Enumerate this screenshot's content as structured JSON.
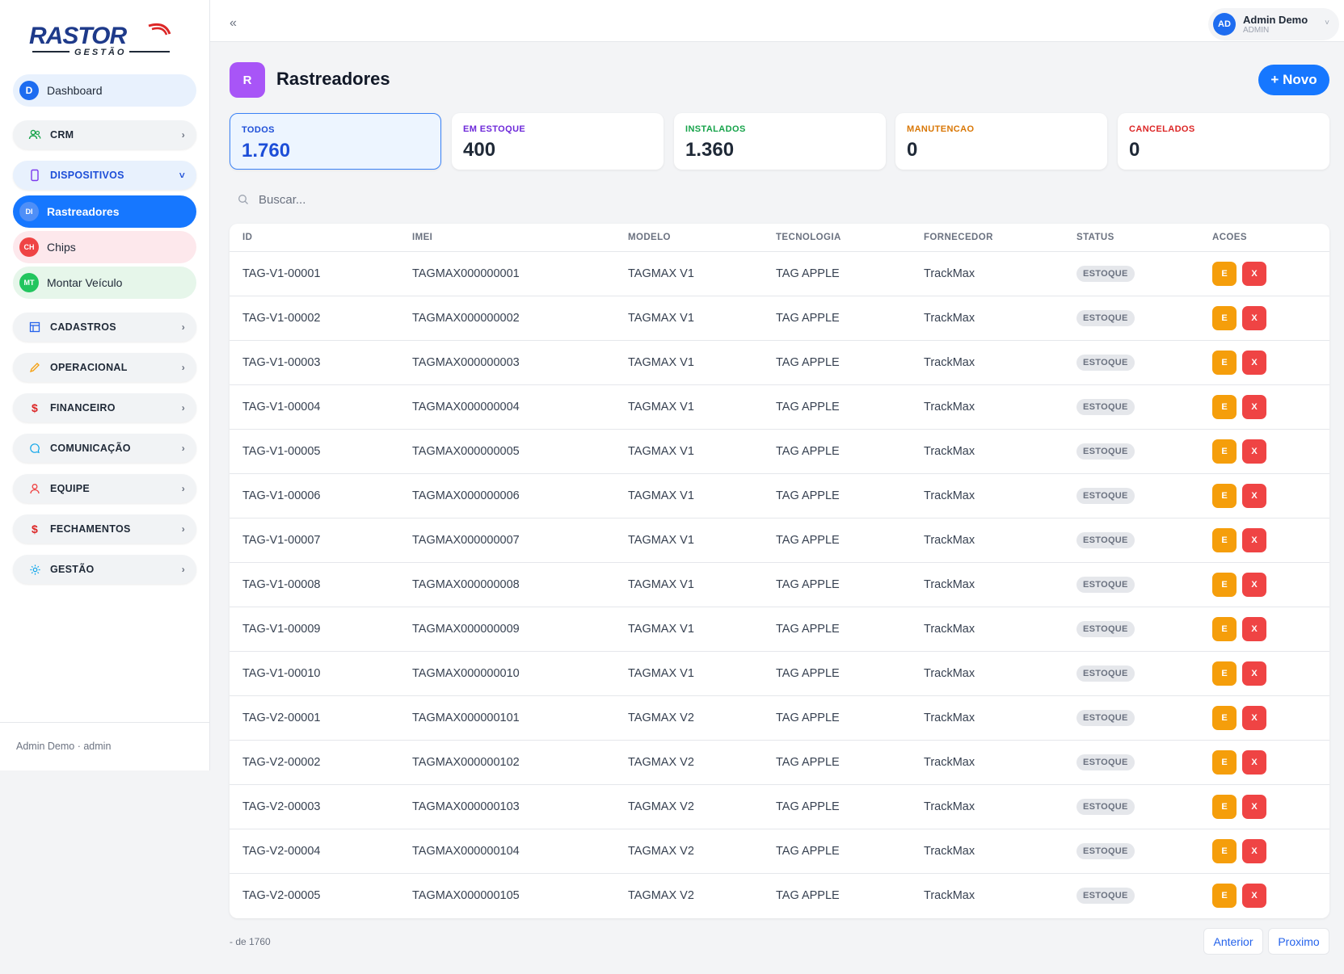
{
  "brand": {
    "logo_text": "RASTOR",
    "logo_sub": "GESTÃO"
  },
  "sidebar": {
    "dashboard": {
      "badge": "D",
      "label": "Dashboard"
    },
    "crm": {
      "label": "CRM"
    },
    "dispositivos": {
      "label": "DISPOSITIVOS",
      "items": [
        {
          "badge": "DI",
          "label": "Rastreadores"
        },
        {
          "badge": "CH",
          "label": "Chips"
        },
        {
          "badge": "MT",
          "label": "Montar Veículo"
        }
      ]
    },
    "groups": [
      "CADASTROS",
      "OPERACIONAL",
      "FINANCEIRO",
      "COMUNICAÇÃO",
      "EQUIPE",
      "FECHAMENTOS",
      "GESTÃO"
    ],
    "footer": "Admin Demo · admin"
  },
  "topbar": {
    "collapse": "«",
    "user": {
      "initials": "AD",
      "name": "Admin Demo",
      "role": "ADMIN"
    }
  },
  "header": {
    "badge": "R",
    "title": "Rastreadores",
    "new_button": "+ Novo"
  },
  "stats": [
    {
      "label": "TODOS",
      "value": "1.760",
      "color": "#1d4ed8"
    },
    {
      "label": "EM ESTOQUE",
      "value": "400",
      "color": "#6d28d9"
    },
    {
      "label": "INSTALADOS",
      "value": "1.360",
      "color": "#16a34a"
    },
    {
      "label": "MANUTENCAO",
      "value": "0",
      "color": "#d97706"
    },
    {
      "label": "CANCELADOS",
      "value": "0",
      "color": "#dc2626"
    }
  ],
  "search": {
    "placeholder": "Buscar..."
  },
  "table": {
    "columns": [
      "ID",
      "IMEI",
      "MODELO",
      "TECNOLOGIA",
      "FORNECEDOR",
      "STATUS",
      "ACOES"
    ],
    "rows": [
      [
        "TAG-V1-00001",
        "TAGMAX000000001",
        "TAGMAX V1",
        "TAG APPLE",
        "TrackMax",
        "ESTOQUE"
      ],
      [
        "TAG-V1-00002",
        "TAGMAX000000002",
        "TAGMAX V1",
        "TAG APPLE",
        "TrackMax",
        "ESTOQUE"
      ],
      [
        "TAG-V1-00003",
        "TAGMAX000000003",
        "TAGMAX V1",
        "TAG APPLE",
        "TrackMax",
        "ESTOQUE"
      ],
      [
        "TAG-V1-00004",
        "TAGMAX000000004",
        "TAGMAX V1",
        "TAG APPLE",
        "TrackMax",
        "ESTOQUE"
      ],
      [
        "TAG-V1-00005",
        "TAGMAX000000005",
        "TAGMAX V1",
        "TAG APPLE",
        "TrackMax",
        "ESTOQUE"
      ],
      [
        "TAG-V1-00006",
        "TAGMAX000000006",
        "TAGMAX V1",
        "TAG APPLE",
        "TrackMax",
        "ESTOQUE"
      ],
      [
        "TAG-V1-00007",
        "TAGMAX000000007",
        "TAGMAX V1",
        "TAG APPLE",
        "TrackMax",
        "ESTOQUE"
      ],
      [
        "TAG-V1-00008",
        "TAGMAX000000008",
        "TAGMAX V1",
        "TAG APPLE",
        "TrackMax",
        "ESTOQUE"
      ],
      [
        "TAG-V1-00009",
        "TAGMAX000000009",
        "TAGMAX V1",
        "TAG APPLE",
        "TrackMax",
        "ESTOQUE"
      ],
      [
        "TAG-V1-00010",
        "TAGMAX000000010",
        "TAGMAX V1",
        "TAG APPLE",
        "TrackMax",
        "ESTOQUE"
      ],
      [
        "TAG-V2-00001",
        "TAGMAX000000101",
        "TAGMAX V2",
        "TAG APPLE",
        "TrackMax",
        "ESTOQUE"
      ],
      [
        "TAG-V2-00002",
        "TAGMAX000000102",
        "TAGMAX V2",
        "TAG APPLE",
        "TrackMax",
        "ESTOQUE"
      ],
      [
        "TAG-V2-00003",
        "TAGMAX000000103",
        "TAGMAX V2",
        "TAG APPLE",
        "TrackMax",
        "ESTOQUE"
      ],
      [
        "TAG-V2-00004",
        "TAGMAX000000104",
        "TAGMAX V2",
        "TAG APPLE",
        "TrackMax",
        "ESTOQUE"
      ],
      [
        "TAG-V2-00005",
        "TAGMAX000000105",
        "TAGMAX V2",
        "TAG APPLE",
        "TrackMax",
        "ESTOQUE"
      ]
    ],
    "action_edit": "E",
    "action_delete": "X"
  },
  "pagination": {
    "info": "- de 1760",
    "prev": "Anterior",
    "next": "Proximo"
  }
}
